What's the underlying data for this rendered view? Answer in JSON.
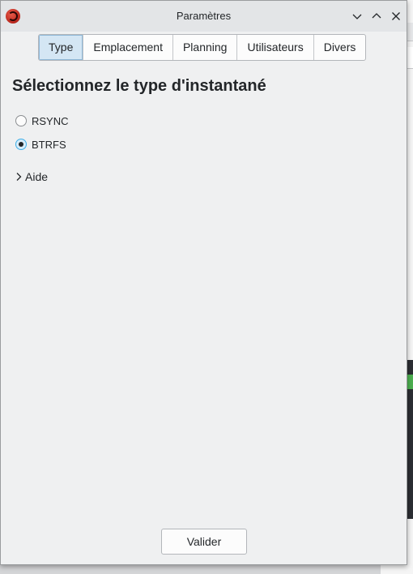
{
  "window": {
    "title": "Paramètres"
  },
  "tabs": [
    {
      "label": "Type",
      "active": true
    },
    {
      "label": "Emplacement",
      "active": false
    },
    {
      "label": "Planning",
      "active": false
    },
    {
      "label": "Utilisateurs",
      "active": false
    },
    {
      "label": "Divers",
      "active": false
    }
  ],
  "main": {
    "heading": "Sélectionnez le type d'instantané",
    "options": [
      {
        "label": "RSYNC",
        "checked": false
      },
      {
        "label": "BTRFS",
        "checked": true
      }
    ],
    "help_label": "Aide"
  },
  "footer": {
    "validate_label": "Valider"
  },
  "colors": {
    "accent": "#3daee9",
    "window_bg": "#eff0f1",
    "active_tab_bg": "#d4e6f4"
  }
}
